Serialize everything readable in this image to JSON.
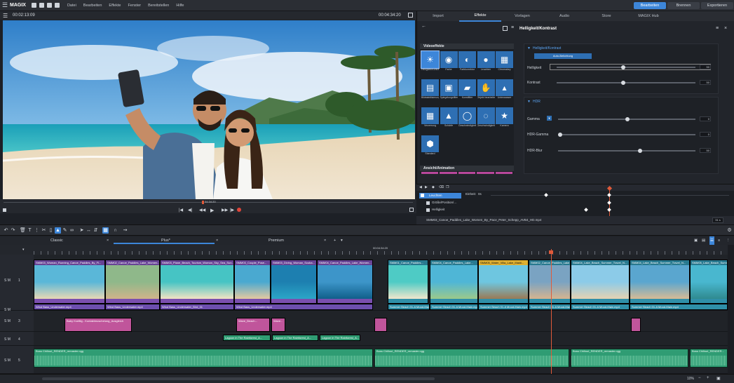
{
  "menubar": {
    "logo": "MAGIX",
    "items": [
      "Datei",
      "Bearbeiten",
      "Effekte",
      "Fenster",
      "Bereitstellen",
      "Hilfe"
    ],
    "modes": [
      "Bearbeiten",
      "Brennen",
      "Exportieren"
    ],
    "active_mode": "Bearbeiten"
  },
  "preview": {
    "time_current": "00:02:13:09",
    "time_total": "00:04:34:20",
    "marker_time": "04:34:20"
  },
  "right_panel": {
    "tabs": [
      "Import",
      "Effekte",
      "Vorlagen",
      "Audio",
      "Store",
      "MAGIX Hub"
    ],
    "active_tab": "Effekte",
    "video_fx_header": "Videoeffekte",
    "video_fx": [
      "Helligkeit/Kontrast",
      "Farbe",
      "Farbkorrektur",
      "Leuchten",
      "Chromakey",
      "Bildstabilisierung",
      "Spiegelungsfilter",
      "Kunstfilter",
      "Objekt bearbeiten",
      "Unterwasser",
      "Verzerrung",
      "Schärfe",
      "Geschwindigkeit",
      "Geschwindigkeit",
      "Kamera",
      "Standard"
    ],
    "anim_header": "Ansicht/Animation",
    "props_title": "Helligkeit/Kontrast",
    "section1_title": "Helligkeit/Kontrast",
    "section1_button": "Auto-Belichtung",
    "section1_rows": [
      {
        "label": "Helligkeit",
        "value": "50"
      },
      {
        "label": "Kontrast",
        "value": "50"
      }
    ],
    "section2_title": "HDR",
    "section2_rows": [
      {
        "label": "Gamma",
        "value": "0"
      },
      {
        "label": "HDR-Gamma",
        "value": "0"
      },
      {
        "label": "HDR-Blur",
        "value": "50"
      }
    ]
  },
  "keyframes": {
    "time": "00:00:02:17",
    "column_label": "Einheit:",
    "column_value": "0s",
    "rows": [
      "Leuchten",
      "Größe/Position/…",
      "Helligkeit"
    ],
    "file_path": "SMM03_Canoe_Paddles_Lake_Women_By_Pace_Peter_Schepp_AVB4_HD.mp4",
    "zoom": "31 s"
  },
  "project_tabs": {
    "tabs": [
      "Classic",
      "Plus*",
      "Premium"
    ],
    "active": "Plus*"
  },
  "timeline": {
    "ruler_marker": "00:04:34:20",
    "track_numbers": [
      "1",
      "2",
      "3",
      "4",
      "5"
    ],
    "track_prefix": "S M",
    "video_clips": [
      "SMM03_Woman_Running_Canoe_Paddles_By_Fl...",
      "SMM02_Canoe_Paddles_Lake_Women...",
      "SMM03_Plane_Beach_Tourism_Woman_Sky_Sea_Sun...",
      "SMM03_Couple_Pose...",
      "SMM03_Diving_Woman_Scuba...",
      "SMM04_Canoe_Paddles_Lake_Women...",
      "SMM01_Canoe_Paddles...",
      "SMM04_Canoe_Paddles_Lake...",
      "SMM05_Water_Villa_Lake_Maldi...",
      "SMM02_Canoe_Paddles_Lake_Ho...",
      "SMM04_Lake_Beach_Summer_Travel_N...",
      "SMM04_Lake_Beach_Summer_Travel_N...",
      "SMM05_Lake_Beach_Summer..."
    ],
    "video_audio": [
      "Wind Bass_Underwater.mp4",
      "Wind Bass_Underwater.mp4",
      "Wind Bass_Underwater_Bird_01",
      "Wind Bass_Underwater.mp4",
      "Summer Beach 01-A Mood-Main.mp4",
      "Summer Beach 01-A Mood-Main.mp4",
      "Summer Beach 01-A Mood-Main.mp4",
      "Summer Beach 01-A Mood-Main.mp4",
      "Summer Beach 01-A Mood-Main.mp4",
      "Summer Beach 01-A Mood-Main.mp4"
    ],
    "title_clips": [
      "Baby Kraftlig - Kontaktmuschelung_Ausgleich",
      "Wave_Beach...",
      "Wave..."
    ],
    "track4_clips": [
      "Lagoon in The Rainforest_A...",
      "Lagoon in The Rainforest_A...",
      "Lagoon in The Rainforest_A..."
    ],
    "music_clips": [
      "Boss Chillout_RENDER_remaster.ogg",
      "Boss Chillout_RENDER_remaster.ogg",
      "Boss Chillout_RENDER_remaster.ogg",
      "Boss Chillout_RENDER..."
    ],
    "zoom": "10%"
  }
}
